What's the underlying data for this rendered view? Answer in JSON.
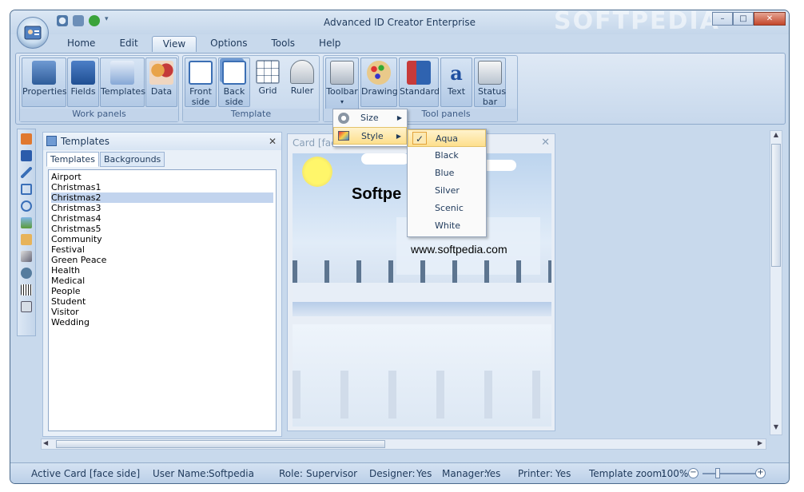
{
  "app": {
    "title": "Advanced ID Creator Enterprise",
    "watermark": "SOFTPEDIA",
    "window_buttons": {
      "minimize": "–",
      "maximize": "□",
      "close": "✕"
    }
  },
  "menu_tabs": [
    "Home",
    "Edit",
    "View",
    "Options",
    "Tools",
    "Help"
  ],
  "ribbon": {
    "work_panels": {
      "label": "Work panels",
      "buttons": [
        "Properties",
        "Fields",
        "Templates",
        "Data"
      ]
    },
    "template": {
      "label": "Template",
      "buttons": [
        "Front side",
        "Back side",
        "Grid",
        "Ruler"
      ]
    },
    "tool_panels": {
      "label": "Tool panels",
      "buttons": [
        "Toolbar",
        "Drawing",
        "Standard",
        "Text",
        "Status bar"
      ]
    }
  },
  "toolbar_menu": {
    "items": [
      {
        "label": "Size",
        "arrow": "▶"
      },
      {
        "label": "Style",
        "arrow": "▶"
      }
    ]
  },
  "style_submenu": {
    "check": "✓",
    "items": [
      "Aqua",
      "Black",
      "Blue",
      "Silver",
      "Scenic",
      "White"
    ],
    "checked": "Aqua"
  },
  "templates_panel": {
    "title": "Templates",
    "close": "✕",
    "tabs": [
      "Templates",
      "Backgrounds"
    ],
    "items": [
      "Airport",
      "Christmas1",
      "Christmas2",
      "Christmas3",
      "Christmas4",
      "Christmas5",
      "Community",
      "Festival",
      "Green Peace",
      "Health",
      "Medical",
      "People",
      "Student",
      "Visitor",
      "Wedding"
    ],
    "selected": "Christmas2"
  },
  "card": {
    "title": "Card [face",
    "close": "✕",
    "headline": "Softpe",
    "url": "www.softpedia.com"
  },
  "status_bar": {
    "active_card": "Active Card [face side]",
    "user_name_label": "User Name:",
    "user_name": "Softpedia",
    "role_label": "Role:",
    "role": "Supervisor",
    "designer_label": "Designer:",
    "designer": "Yes",
    "manager_label": "Manager:",
    "manager": "Yes",
    "printer_label": "Printer:",
    "printer": "Yes",
    "zoom_label": "Template zoom:",
    "zoom": "100%"
  },
  "colors": {
    "accent": "#1e395b",
    "ribbon": "#c7d8ec",
    "selection": "#c2d4ee",
    "menu_highlight": "#fddf8c"
  }
}
